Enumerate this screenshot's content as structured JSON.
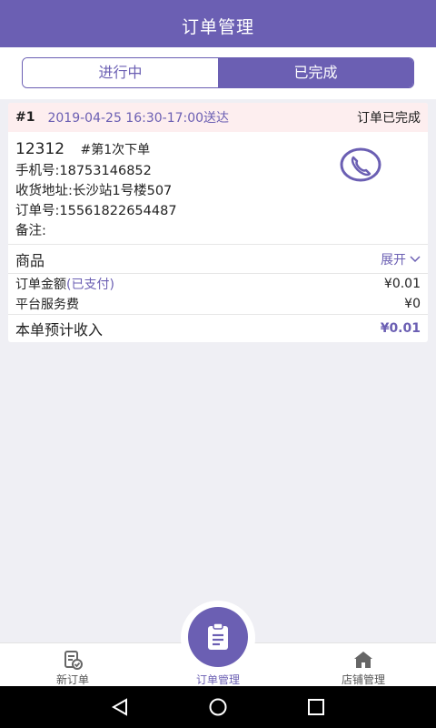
{
  "header": {
    "title": "订单管理"
  },
  "tabs": [
    {
      "label": "进行中",
      "active": false
    },
    {
      "label": "已完成",
      "active": true
    }
  ],
  "order": {
    "index": "#1",
    "delivery_time": "2019-04-25 16:30-17:00送达",
    "status": "订单已完成",
    "code": "12312",
    "times": "#第1次下单",
    "phone": "手机号:18753146852",
    "address": "收货地址:长沙站1号楼507",
    "order_no": "订单号:15561822654487",
    "remark": "备注:",
    "goods_label": "商品",
    "expand_label": "展开",
    "amount_label": "订单金额",
    "paid_label": "(已支付)",
    "amount_value": "¥0.01",
    "service_fee_label": "平台服务费",
    "service_fee_value": "¥0",
    "income_label": "本单预计收入",
    "income_value": "¥0.01"
  },
  "tabbar": {
    "items": [
      {
        "label": "新订单",
        "icon": "new-order-icon"
      },
      {
        "label": "订单管理",
        "icon": "clipboard-icon",
        "active": true
      },
      {
        "label": "店铺管理",
        "icon": "shop-icon"
      }
    ]
  },
  "colors": {
    "accent": "#6b5fb3",
    "header_bg": "#6b5fb3",
    "card_top_bg": "#fdeeef",
    "page_bg": "#efeff4"
  }
}
